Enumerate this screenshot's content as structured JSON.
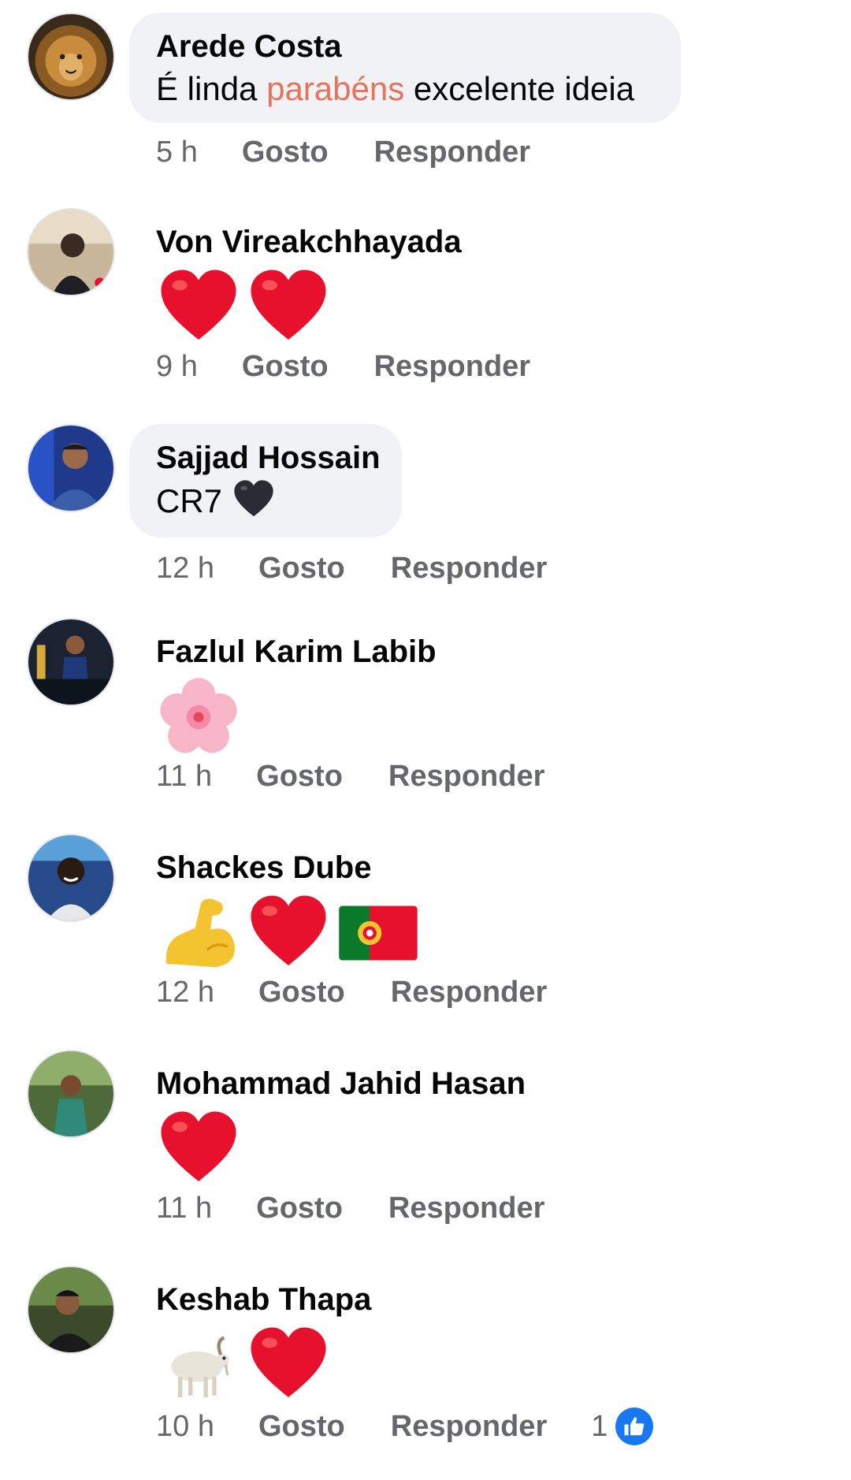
{
  "comments": [
    {
      "author": "Arede Costa",
      "text_before": "É linda ",
      "text_highlight": "parabéns",
      "text_after": " excelente ideia",
      "time": "5 h",
      "like_label": "Gosto",
      "reply_label": "Responder",
      "avatar_icon": "lion-avatar"
    },
    {
      "author": "Von Vireakchhayada",
      "emojis": [
        "red-heart-emoji",
        "red-heart-emoji"
      ],
      "time": "9 h",
      "like_label": "Gosto",
      "reply_label": "Responder"
    },
    {
      "author": "Sajjad Hossain",
      "text": "CR7 ",
      "emojis": [
        "black-heart-emoji"
      ],
      "time": "12 h",
      "like_label": "Gosto",
      "reply_label": "Responder"
    },
    {
      "author": "Fazlul Karim Labib",
      "emojis": [
        "cherry-blossom-emoji"
      ],
      "time": "11 h",
      "like_label": "Gosto",
      "reply_label": "Responder"
    },
    {
      "author": "Shackes Dube",
      "emojis": [
        "flexed-biceps-emoji",
        "red-heart-emoji",
        "portugal-flag-emoji"
      ],
      "time": "12 h",
      "like_label": "Gosto",
      "reply_label": "Responder"
    },
    {
      "author": "Mohammad Jahid Hasan",
      "emojis": [
        "red-heart-emoji"
      ],
      "time": "11 h",
      "like_label": "Gosto",
      "reply_label": "Responder"
    },
    {
      "author": "Keshab Thapa",
      "emojis": [
        "goat-emoji",
        "red-heart-emoji"
      ],
      "time": "10 h",
      "like_label": "Gosto",
      "reply_label": "Responder",
      "reaction_count": "1",
      "reaction_icon": "thumbs-up-icon"
    }
  ],
  "colors": {
    "bubble": "#f0f2f5",
    "meta_text": "#65676b",
    "highlight": "#e9725b",
    "like_blue": "#1877f2",
    "heart_red": "#e8112d"
  }
}
